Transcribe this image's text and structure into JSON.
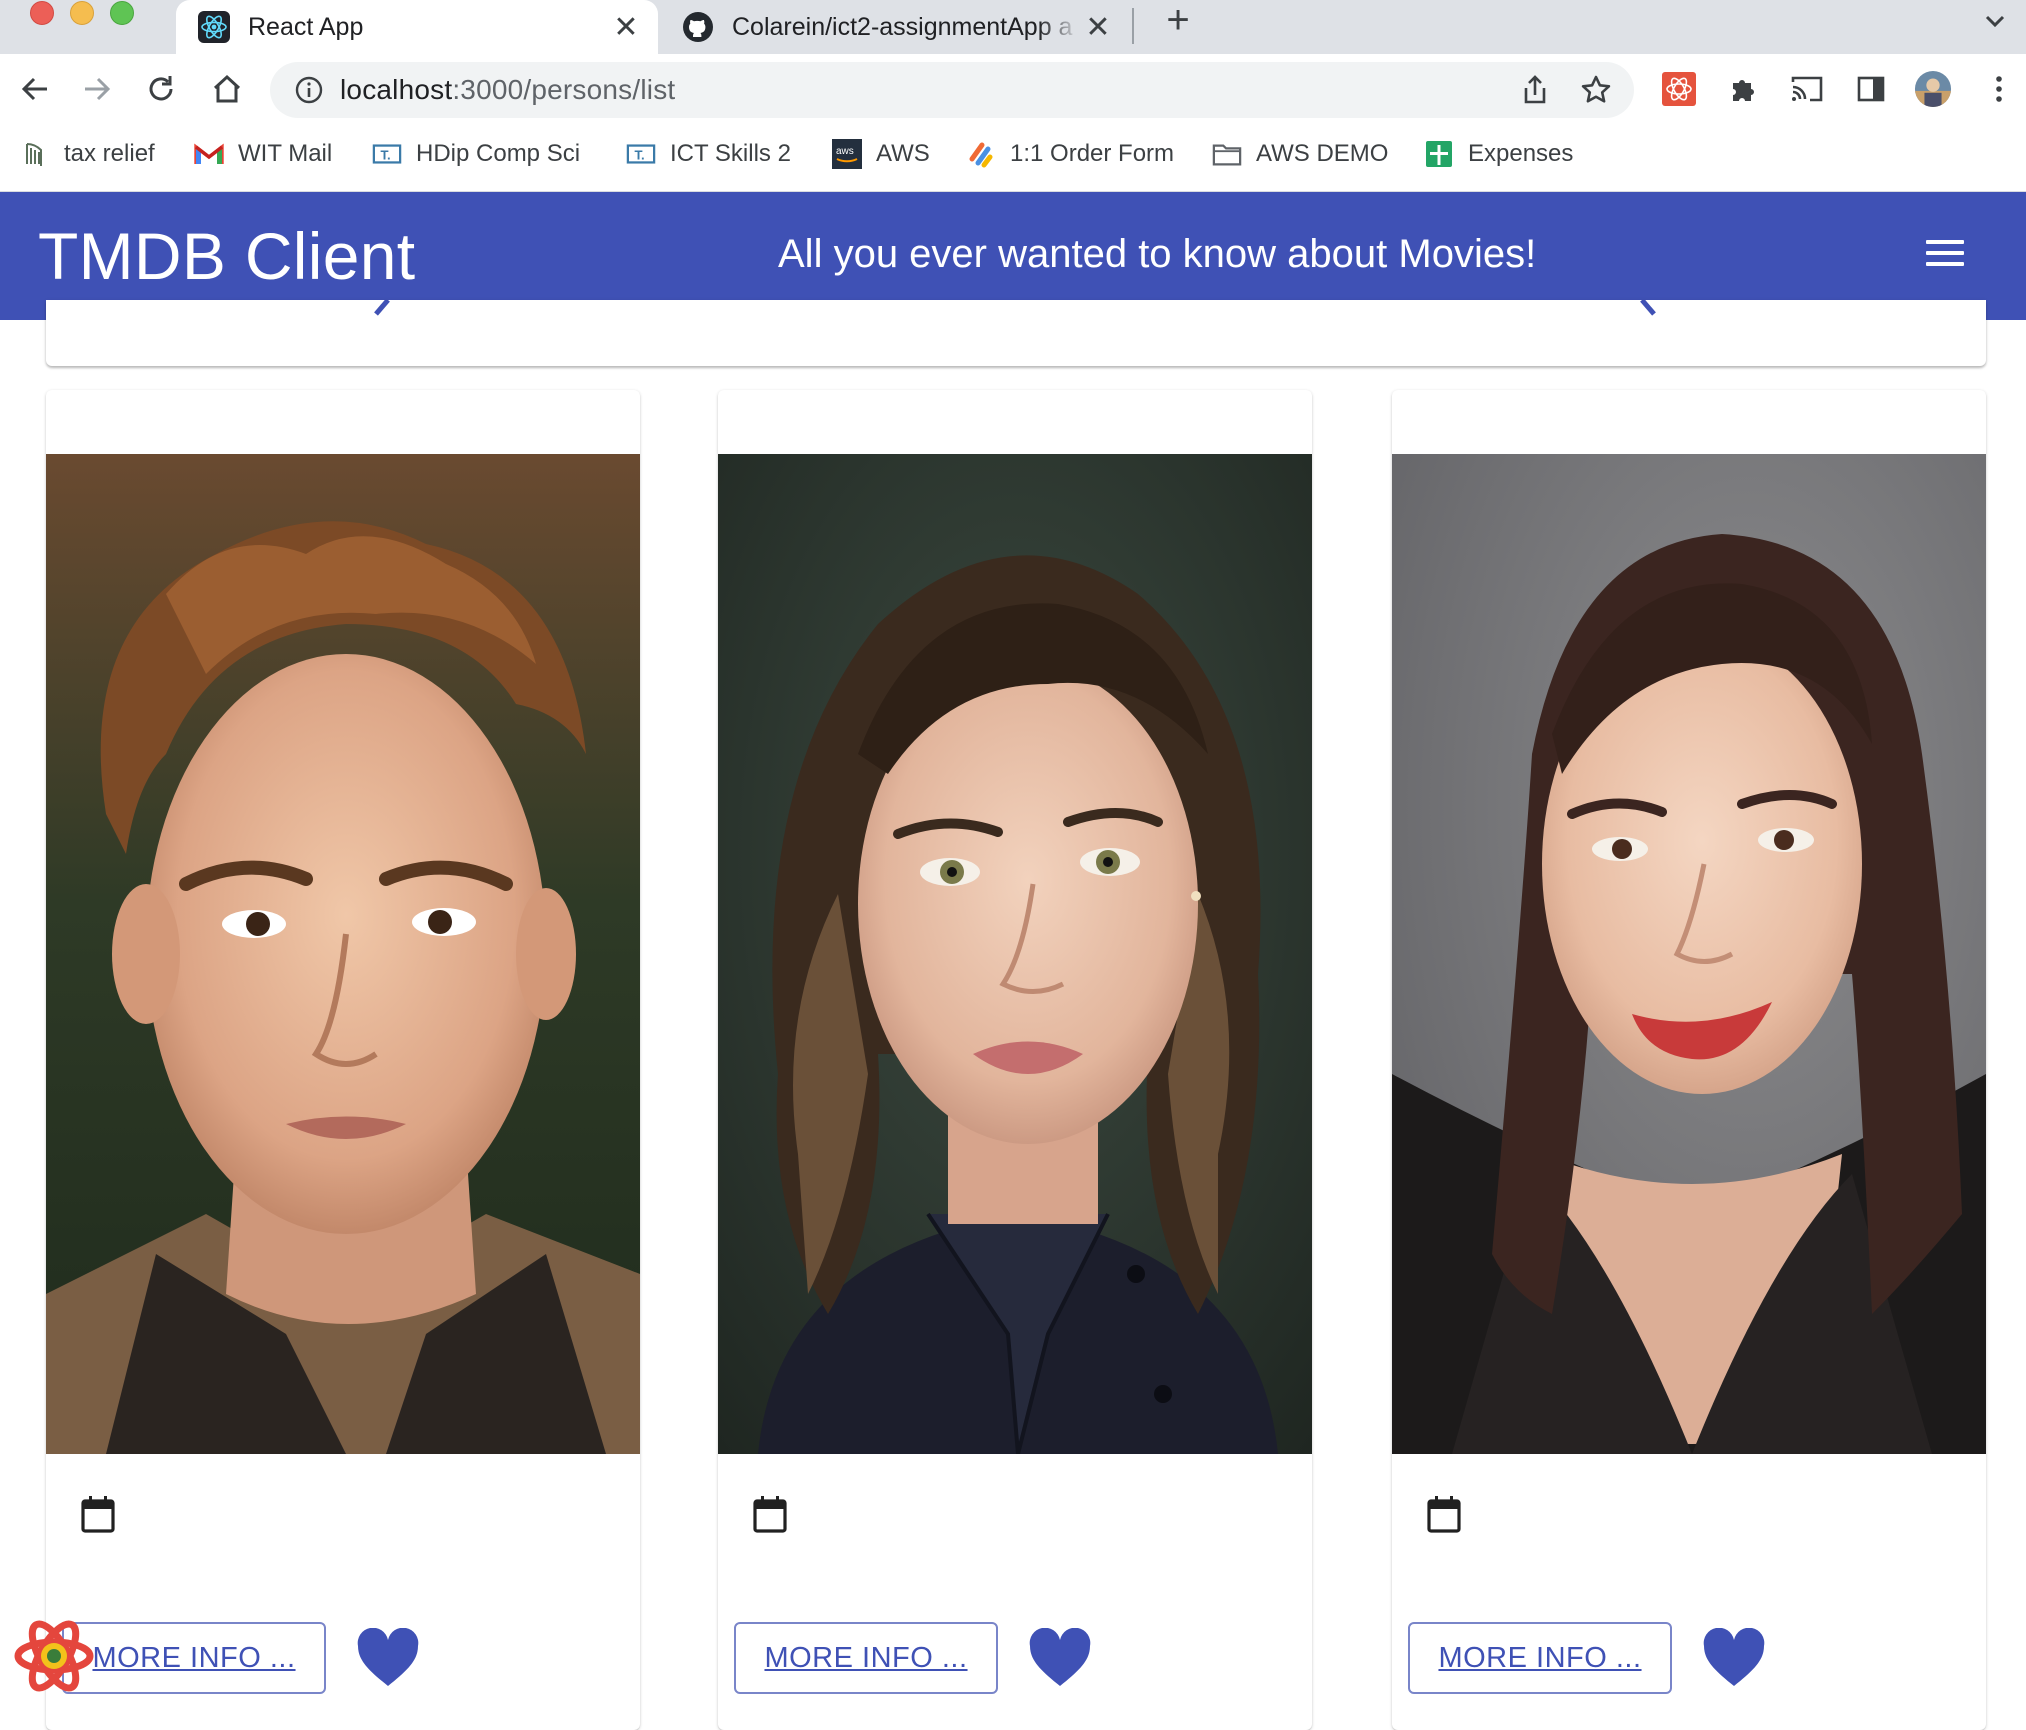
{
  "browser": {
    "tabs": [
      {
        "title": "React App",
        "favicon": "react-icon",
        "active": true
      },
      {
        "title": "Colarein/ict2-assignmentApp a",
        "favicon": "github-icon",
        "active": false
      }
    ],
    "url_host": "localhost",
    "url_path": ":3000/persons/list",
    "bookmarks": [
      {
        "label": "tax relief",
        "icon": "revenue-harp-icon"
      },
      {
        "label": "WIT Mail",
        "icon": "gmail-icon"
      },
      {
        "label": "HDip Comp Sci",
        "icon": "tutors-icon"
      },
      {
        "label": "ICT Skills 2",
        "icon": "tutors-icon"
      },
      {
        "label": "AWS",
        "icon": "aws-icon"
      },
      {
        "label": "1:1 Order Form",
        "icon": "form-icon"
      },
      {
        "label": "AWS DEMO",
        "icon": "folder-icon"
      },
      {
        "label": "Expenses",
        "icon": "sheets-icon"
      }
    ]
  },
  "app": {
    "brand": "TMDB Client",
    "tagline": "All you ever wanted to know about Movies!",
    "accent_color": "#3f51b5"
  },
  "persons": [
    {
      "more_info_label": "MORE INFO ...",
      "photo": "portrait-young-man-curly-hair"
    },
    {
      "more_info_label": "MORE INFO ...",
      "photo": "portrait-woman-dark-wavy-hair"
    },
    {
      "more_info_label": "MORE INFO ...",
      "photo": "portrait-woman-smiling-red-lips"
    }
  ]
}
